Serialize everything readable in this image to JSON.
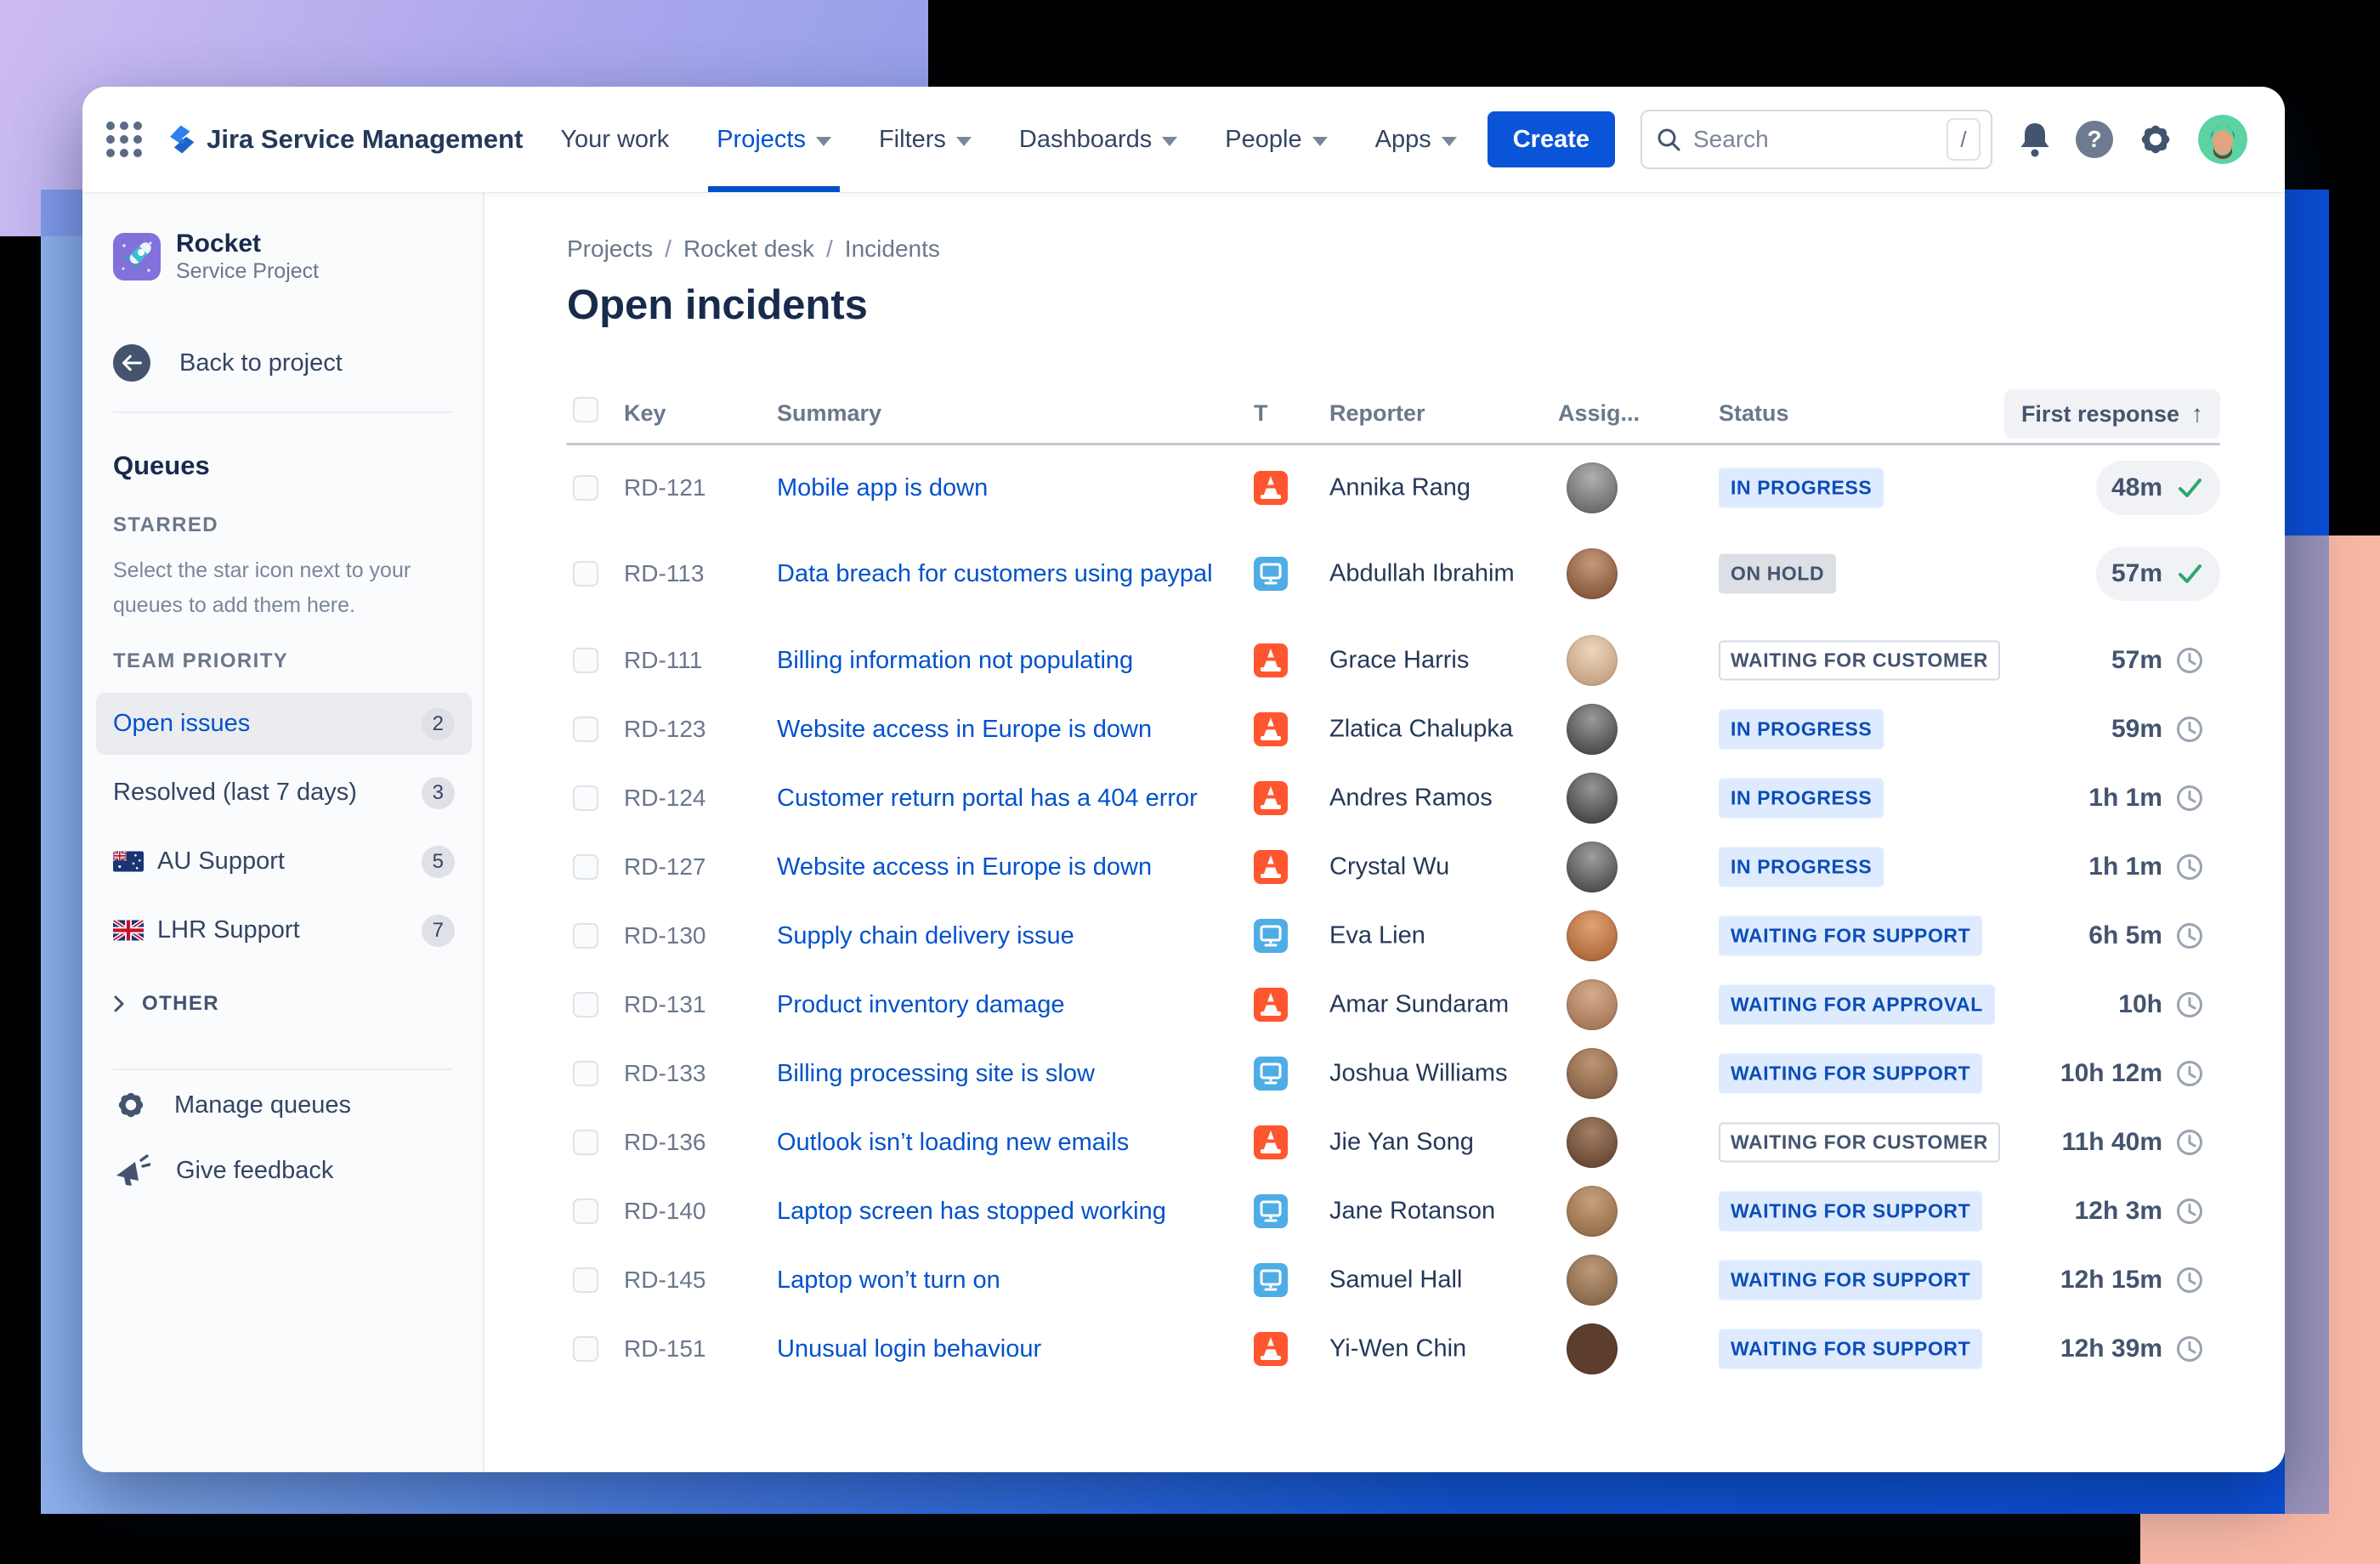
{
  "nav": {
    "app_title": "Jira Service Management",
    "items": [
      {
        "label": "Your work"
      },
      {
        "label": "Projects"
      },
      {
        "label": "Filters"
      },
      {
        "label": "Dashboards"
      },
      {
        "label": "People"
      },
      {
        "label": "Apps"
      }
    ],
    "active_item": "Projects",
    "create_label": "Create",
    "search_placeholder": "Search",
    "search_shortcut": "/",
    "help_glyph": "?"
  },
  "sidebar": {
    "project_name": "Rocket",
    "project_type": "Service Project",
    "back_label": "Back to project",
    "queues_heading": "Queues",
    "starred_heading": "STARRED",
    "starred_hint": "Select the star icon next to your queues to add them here.",
    "team_heading": "TEAM PRIORITY",
    "queues": [
      {
        "label": "Open issues",
        "count": "2",
        "active": true,
        "flag": null
      },
      {
        "label": "Resolved (last 7 days)",
        "count": "3",
        "active": false,
        "flag": null
      },
      {
        "label": "AU Support",
        "count": "5",
        "active": false,
        "flag": "au"
      },
      {
        "label": "LHR Support",
        "count": "7",
        "active": false,
        "flag": "uk"
      }
    ],
    "other_label": "OTHER",
    "manage_label": "Manage queues",
    "feedback_label": "Give feedback"
  },
  "main": {
    "breadcrumb": [
      "Projects",
      "Rocket desk",
      "Incidents"
    ],
    "title": "Open incidents",
    "table": {
      "columns": {
        "key": "Key",
        "summary": "Summary",
        "type": "T",
        "reporter": "Reporter",
        "assignee": "Assig...",
        "status": "Status",
        "first_response": "First response"
      },
      "sort_column": "First response",
      "sort_arrow": "↑",
      "rows": [
        {
          "key": "RD-121",
          "summary": "Mobile app is down",
          "type": "incident",
          "reporter": "Annika Rang",
          "status": "IN PROGRESS",
          "status_style": "blue",
          "response": "48m",
          "response_state": "met",
          "avatar": "#6e6e6e",
          "avatar_hi": "#b0b0b0",
          "two_line": false
        },
        {
          "key": "RD-113",
          "summary": "Data breach for customers using paypal",
          "type": "request",
          "reporter": "Abdullah Ibrahim",
          "status": "ON HOLD",
          "status_style": "gray",
          "response": "57m",
          "response_state": "met",
          "avatar": "#8a5a3f",
          "avatar_hi": "#c49a78",
          "two_line": true
        },
        {
          "key": "RD-111",
          "summary": "Billing information not populating",
          "type": "incident",
          "reporter": "Grace Harris",
          "status": "WAITING FOR CUSTOMER",
          "status_style": "outline",
          "response": "57m",
          "response_state": "pending",
          "avatar": "#c8a384",
          "avatar_hi": "#ecd6bd",
          "two_line": false
        },
        {
          "key": "RD-123",
          "summary": "Website access in Europe is down",
          "type": "incident",
          "reporter": "Zlatica Chalupka",
          "status": "IN PROGRESS",
          "status_style": "blue",
          "response": "59m",
          "response_state": "pending",
          "avatar": "#4f4f4f",
          "avatar_hi": "#9a9a9a",
          "two_line": false
        },
        {
          "key": "RD-124",
          "summary": "Customer return portal has a 404 error",
          "type": "incident",
          "reporter": "Andres Ramos",
          "status": "IN PROGRESS",
          "status_style": "blue",
          "response": "1h 1m",
          "response_state": "pending",
          "avatar": "#4a4a4a",
          "avatar_hi": "#969696",
          "two_line": false
        },
        {
          "key": "RD-127",
          "summary": "Website access in Europe is down",
          "type": "incident",
          "reporter": "Crystal Wu",
          "status": "IN PROGRESS",
          "status_style": "blue",
          "response": "1h 1m",
          "response_state": "pending",
          "avatar": "#525252",
          "avatar_hi": "#9e9e9e",
          "two_line": false
        },
        {
          "key": "RD-130",
          "summary": "Supply chain delivery issue",
          "type": "request",
          "reporter": "Eva Lien",
          "status": "WAITING FOR SUPPORT",
          "status_style": "blue",
          "response": "6h 5m",
          "response_state": "pending",
          "avatar": "#b06a3e",
          "avatar_hi": "#e0a274",
          "two_line": false
        },
        {
          "key": "RD-131",
          "summary": "Product inventory damage",
          "type": "incident",
          "reporter": "Amar Sundaram",
          "status": "WAITING FOR APPROVAL",
          "status_style": "blue",
          "response": "10h",
          "response_state": "pending",
          "avatar": "#a8795a",
          "avatar_hi": "#d4ab8a",
          "two_line": false
        },
        {
          "key": "RD-133",
          "summary": "Billing processing site is slow",
          "type": "request",
          "reporter": "Joshua Williams",
          "status": "WAITING FOR SUPPORT",
          "status_style": "blue",
          "response": "10h 12m",
          "response_state": "pending",
          "avatar": "#8a6248",
          "avatar_hi": "#bd9674",
          "two_line": false
        },
        {
          "key": "RD-136",
          "summary": "Outlook isn’t loading new emails",
          "type": "incident",
          "reporter": "Jie Yan Song",
          "status": "WAITING FOR CUSTOMER",
          "status_style": "outline",
          "response": "11h 40m",
          "response_state": "pending",
          "avatar": "#6b4a38",
          "avatar_hi": "#a37f63",
          "two_line": false
        },
        {
          "key": "RD-140",
          "summary": "Laptop screen has stopped working",
          "type": "request",
          "reporter": "Jane Rotanson",
          "status": "WAITING FOR SUPPORT",
          "status_style": "blue",
          "response": "12h 3m",
          "response_state": "pending",
          "avatar": "#97704f",
          "avatar_hi": "#c7a27c",
          "two_line": false
        },
        {
          "key": "RD-145",
          "summary": "Laptop won’t turn on",
          "type": "request",
          "reporter": "Samuel Hall",
          "status": "WAITING FOR SUPPORT",
          "status_style": "blue",
          "response": "12h 15m",
          "response_state": "pending",
          "avatar": "#8a6a4e",
          "avatar_hi": "#bc9a78",
          "two_line": false
        },
        {
          "key": "RD-151",
          "summary": "Unusual login behaviour",
          "type": "incident",
          "reporter": "Yi-Wen Chin",
          "status": "WAITING FOR SUPPORT",
          "status_style": "blue",
          "response": "12h 39m",
          "response_state": "pending",
          "avatar": "#5c3d2e",
          "avatar_hi": "#97neutral",
          "two_line": false
        }
      ]
    }
  },
  "colors": {
    "accent": "#0052CC",
    "incident_icon": "#FF5630",
    "request_icon": "#4FADE6",
    "in_progress_bg": "#DEEBFF",
    "in_progress_text": "#0B4DB8",
    "on_hold_bg": "#DCDFE4",
    "met_check_green": "#2BA770",
    "band_blue": "#0A4FD9",
    "purple_block": "#C7B7EF",
    "salmon_block": "#F8B7A4",
    "avatar_green": "#5BD3A2"
  }
}
